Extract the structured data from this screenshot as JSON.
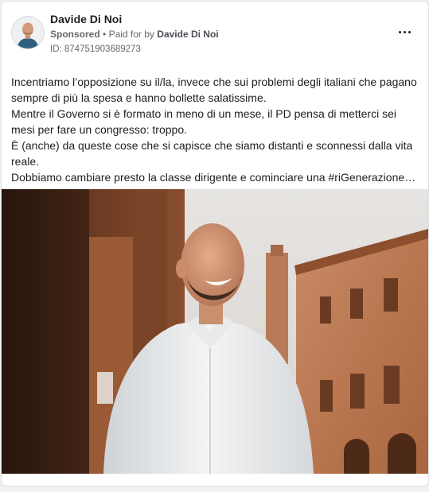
{
  "post": {
    "author": "Davide Di Noi",
    "sponsored_label": "Sponsored",
    "paid_for_prefix": "Paid for by",
    "paid_for_by": "Davide Di Noi",
    "separator": "•",
    "ad_id": "ID: 874751903689273",
    "more_icon": "more-horizontal-icon",
    "body_lines": [
      "Incentriamo l’opposizione su il/la, invece che sui problemi degli italiani che pagano sempre di più la spesa e hanno bollette salatissime.",
      "Mentre il Governo si è formato in meno di un mese, il PD pensa di metterci sei mesi per fare un congresso: troppo.",
      "È (anche) da queste cose che si capisce che siamo distanti e sconnessi dalla vita reale.",
      "Dobbiamo cambiare presto la classe dirigente e cominciare una #riGenerazione…"
    ]
  },
  "colors": {
    "text_primary": "#1c1e21",
    "text_secondary": "#65676b",
    "card_border": "#dddfe2",
    "background": "#f0f2f5"
  }
}
